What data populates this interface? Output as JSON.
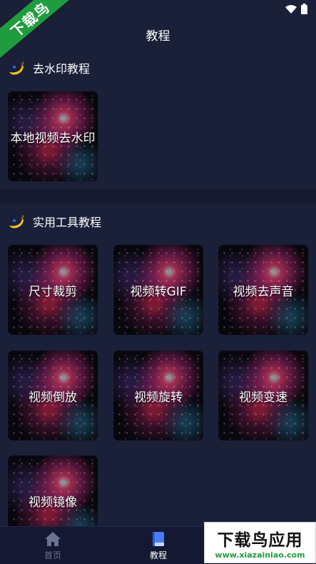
{
  "watermark": {
    "corner_text": "下载鸟",
    "badge_title": "下载鸟应用",
    "badge_url": "www.xiazainiao.com"
  },
  "header": {
    "title": "教程"
  },
  "sections": [
    {
      "title": "去水印教程",
      "items": [
        "本地视频去水印"
      ]
    },
    {
      "title": "实用工具教程",
      "items": [
        "尺寸裁剪",
        "视频转GIF",
        "视频去声音",
        "视频倒放",
        "视频旋转",
        "视频变速",
        "视频镜像"
      ]
    }
  ],
  "bottom_nav": [
    {
      "label": "首页",
      "icon": "home-icon",
      "active": false
    },
    {
      "label": "教程",
      "icon": "book-icon",
      "active": true
    }
  ],
  "colors": {
    "background": "#1b2039",
    "nav_bg": "#141831",
    "inactive": "#6c7391",
    "active": "#ffffff"
  }
}
